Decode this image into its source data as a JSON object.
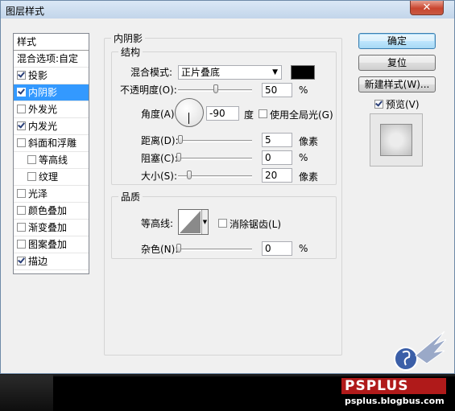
{
  "window": {
    "title": "图层样式",
    "close_glyph": "✕"
  },
  "left_panel": {
    "header": "样式",
    "items": [
      {
        "label": "混合选项:自定",
        "checkbox": false,
        "checked": false,
        "selected": false,
        "indent": false
      },
      {
        "label": "投影",
        "checkbox": true,
        "checked": true,
        "selected": false,
        "indent": false
      },
      {
        "label": "内阴影",
        "checkbox": true,
        "checked": true,
        "selected": true,
        "indent": false
      },
      {
        "label": "外发光",
        "checkbox": true,
        "checked": false,
        "selected": false,
        "indent": false
      },
      {
        "label": "内发光",
        "checkbox": true,
        "checked": true,
        "selected": false,
        "indent": false
      },
      {
        "label": "斜面和浮雕",
        "checkbox": true,
        "checked": false,
        "selected": false,
        "indent": false
      },
      {
        "label": "等高线",
        "checkbox": true,
        "checked": false,
        "selected": false,
        "indent": true
      },
      {
        "label": "纹理",
        "checkbox": true,
        "checked": false,
        "selected": false,
        "indent": true
      },
      {
        "label": "光泽",
        "checkbox": true,
        "checked": false,
        "selected": false,
        "indent": false
      },
      {
        "label": "颜色叠加",
        "checkbox": true,
        "checked": false,
        "selected": false,
        "indent": false
      },
      {
        "label": "渐变叠加",
        "checkbox": true,
        "checked": false,
        "selected": false,
        "indent": false
      },
      {
        "label": "图案叠加",
        "checkbox": true,
        "checked": false,
        "selected": false,
        "indent": false
      },
      {
        "label": "描边",
        "checkbox": true,
        "checked": true,
        "selected": false,
        "indent": false
      }
    ]
  },
  "inner_shadow": {
    "section_title": "内阴影",
    "structure": {
      "title": "结构",
      "blend_mode_label": "混合模式:",
      "blend_mode_value": "正片叠底",
      "shadow_color": "#000000",
      "opacity_label": "不透明度(O):",
      "opacity_value": "50",
      "opacity_unit": "%",
      "angle_label": "角度(A):",
      "angle_value": "-90",
      "angle_unit": "度",
      "global_light_label": "使用全局光(G)",
      "global_light_checked": false,
      "distance_label": "距离(D):",
      "distance_value": "5",
      "distance_unit": "像素",
      "choke_label": "阻塞(C):",
      "choke_value": "0",
      "choke_unit": "%",
      "size_label": "大小(S):",
      "size_value": "20",
      "size_unit": "像素"
    },
    "quality": {
      "title": "品质",
      "contour_label": "等高线:",
      "anti_alias_label": "消除锯齿(L)",
      "anti_alias_checked": false,
      "noise_label": "杂色(N):",
      "noise_value": "0",
      "noise_unit": "%"
    }
  },
  "buttons": {
    "ok": "确定",
    "reset": "复位",
    "new_style": "新建样式(W)...",
    "preview_label": "预览(V)",
    "preview_checked": true
  },
  "watermark": {
    "brand": "PSPLUS",
    "url": "psplus.blogbus.com"
  }
}
